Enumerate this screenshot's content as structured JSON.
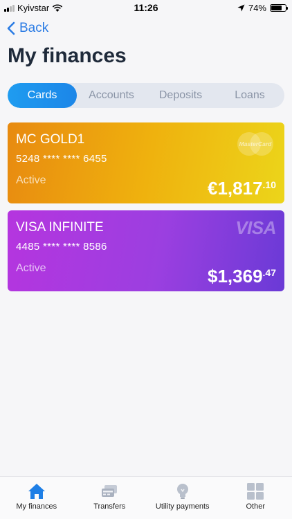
{
  "status_bar": {
    "carrier": "Kyivstar",
    "time": "11:26",
    "battery_text": "74%",
    "battery_level": 0.74
  },
  "nav": {
    "back_label": "Back",
    "title": "My finances"
  },
  "tabs": [
    {
      "label": "Cards",
      "active": true
    },
    {
      "label": "Accounts",
      "active": false
    },
    {
      "label": "Deposits",
      "active": false
    },
    {
      "label": "Loans",
      "active": false
    }
  ],
  "cards": [
    {
      "name": "MC GOLD1",
      "number": "5248 **** **** 6455",
      "status": "Active",
      "amount_main": "€1,817",
      "amount_cents": ".10",
      "brand": "mastercard-logo",
      "brand_text": "MasterCard"
    },
    {
      "name": "VISA INFINITE",
      "number": "4485 **** **** 8586",
      "status": "Active",
      "amount_main": "$1,369",
      "amount_cents": ".47",
      "brand": "visa-logo",
      "brand_text": "VISA"
    }
  ],
  "tabbar": [
    {
      "label": "My finances",
      "icon": "home-icon",
      "active": true
    },
    {
      "label": "Transfers",
      "icon": "transfers-icon",
      "active": false
    },
    {
      "label": "Utility payments",
      "icon": "lightbulb-icon",
      "active": false
    },
    {
      "label": "Other",
      "icon": "grid-icon",
      "active": false
    }
  ],
  "colors": {
    "accent": "#2a7be4",
    "active_tab": "#1f9cf0",
    "gold_card_start": "#e88a10",
    "gold_card_end": "#ecd51a",
    "visa_card_start": "#b535df",
    "visa_card_end": "#6a3ad6"
  }
}
